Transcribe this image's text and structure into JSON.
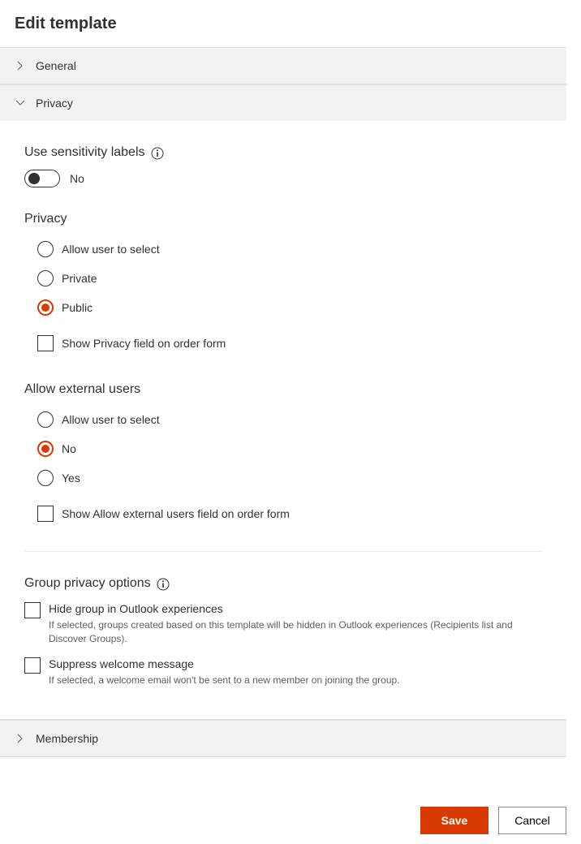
{
  "title": "Edit template",
  "sections": {
    "general": {
      "label": "General",
      "expanded": false
    },
    "privacy": {
      "label": "Privacy",
      "expanded": true
    },
    "membership": {
      "label": "Membership",
      "expanded": false
    }
  },
  "sensitivity": {
    "title": "Use sensitivity labels",
    "value_label": "No",
    "value": false
  },
  "privacy": {
    "title": "Privacy",
    "options": {
      "allow_select": "Allow user to select",
      "private": "Private",
      "public": "Public"
    },
    "selected": "public",
    "show_field_label": "Show Privacy field on order form",
    "show_field": false
  },
  "external": {
    "title": "Allow external users",
    "options": {
      "allow_select": "Allow user to select",
      "no": "No",
      "yes": "Yes"
    },
    "selected": "no",
    "show_field_label": "Show Allow external users field on order form",
    "show_field": false
  },
  "group_options": {
    "title": "Group privacy options",
    "hide_outlook": {
      "label": "Hide group in Outlook experiences",
      "desc": "If selected, groups created based on this template will be hidden in Outlook experiences (Recipients list and Discover Groups).",
      "checked": false
    },
    "suppress_welcome": {
      "label": "Suppress welcome message",
      "desc": "If selected, a welcome email won't be sent to a new member on joining the group.",
      "checked": false
    }
  },
  "footer": {
    "save": "Save",
    "cancel": "Cancel"
  }
}
